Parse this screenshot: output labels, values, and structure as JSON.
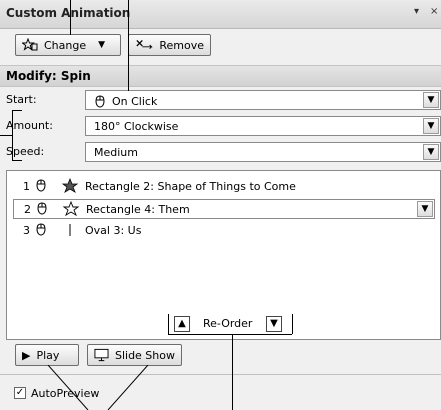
{
  "panel": {
    "title": "Custom Animation",
    "dropdown_glyph": "▾",
    "close_glyph": "×"
  },
  "toolbar": {
    "change_label": "Change",
    "remove_label": "Remove"
  },
  "modify": {
    "header": "Modify: Spin",
    "start_label": "Start:",
    "start_value": "On Click",
    "amount_label": "Amount:",
    "amount_value": "180° Clockwise",
    "speed_label": "Speed:",
    "speed_value": "Medium"
  },
  "animation_list": {
    "items": [
      {
        "num": "1",
        "text": "Rectangle 2: Shape of Things to Come",
        "selected": false
      },
      {
        "num": "2",
        "text": "Rectangle 4: Them",
        "selected": true
      },
      {
        "num": "3",
        "text": "Oval 3: Us",
        "selected": false
      }
    ]
  },
  "reorder": {
    "label": "Re-Order"
  },
  "playback": {
    "play_label": "Play",
    "slideshow_label": "Slide Show"
  },
  "autopreview": {
    "label": "AutoPreview",
    "checked": true
  },
  "icons": {
    "dropdown_arrow": "▼",
    "up_arrow": "▲",
    "down_arrow": "▼",
    "play": "▶",
    "check": "✓"
  }
}
